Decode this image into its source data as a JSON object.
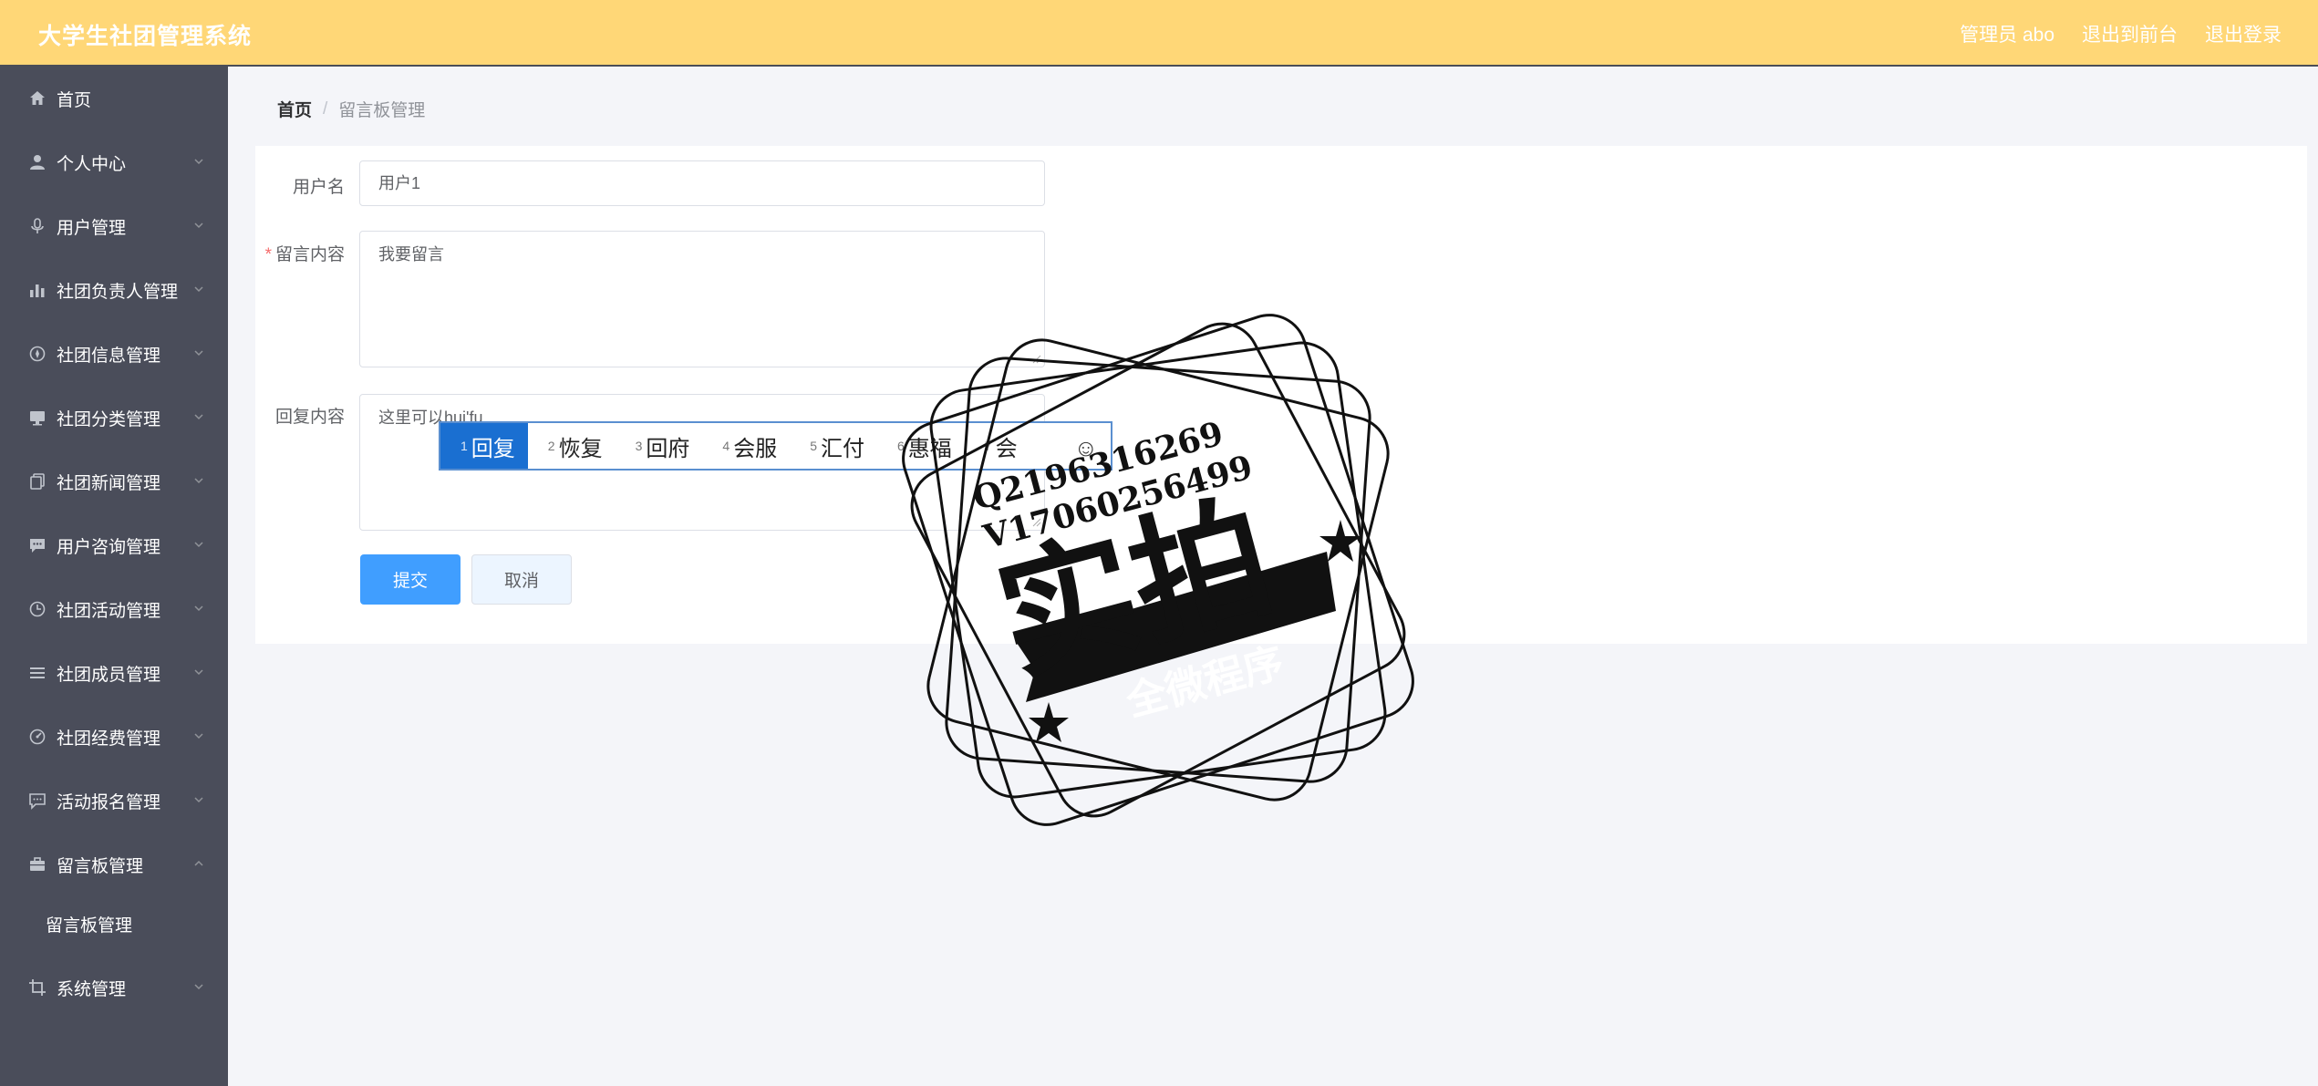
{
  "header": {
    "title": "大学生社团管理系统",
    "user": "管理员 abo",
    "to_frontend": "退出到前台",
    "logout": "退出登录"
  },
  "sidebar": {
    "items": [
      {
        "label": "首页",
        "icon": "home-icon"
      },
      {
        "label": "个人中心",
        "icon": "user-icon"
      },
      {
        "label": "用户管理",
        "icon": "microphone-icon"
      },
      {
        "label": "社团负责人管理",
        "icon": "bar-chart-icon"
      },
      {
        "label": "社团信息管理",
        "icon": "compass-icon"
      },
      {
        "label": "社团分类管理",
        "icon": "monitor-icon"
      },
      {
        "label": "社团新闻管理",
        "icon": "copy-icon"
      },
      {
        "label": "用户咨询管理",
        "icon": "chat-icon"
      },
      {
        "label": "社团活动管理",
        "icon": "clock-icon"
      },
      {
        "label": "社团成员管理",
        "icon": "list-icon"
      },
      {
        "label": "社团经费管理",
        "icon": "gauge-icon"
      },
      {
        "label": "活动报名管理",
        "icon": "message-icon"
      },
      {
        "label": "留言板管理",
        "icon": "suitcase-icon"
      },
      {
        "label": "系统管理",
        "icon": "crop-icon"
      }
    ],
    "sub_item": "留言板管理"
  },
  "breadcrumb": {
    "home": "首页",
    "separator": "/",
    "current": "留言板管理"
  },
  "form": {
    "username_label": "用户名",
    "username_value": "用户1",
    "required_mark": "*",
    "content_label": "留言内容",
    "content_value": "我要留言",
    "reply_label": "回复内容",
    "reply_value": "这里可以hui'fu",
    "submit": "提交",
    "cancel": "取消"
  },
  "ime": {
    "candidates": [
      {
        "num": "1",
        "text": "回复"
      },
      {
        "num": "2",
        "text": "恢复"
      },
      {
        "num": "3",
        "text": "回府"
      },
      {
        "num": "4",
        "text": "会服"
      },
      {
        "num": "5",
        "text": "汇付"
      },
      {
        "num": "6",
        "text": "惠福"
      },
      {
        "num": "7",
        "text": "会"
      }
    ],
    "emoji": "☺"
  },
  "watermark": {
    "line1": "Q2196316269",
    "line2": "V17060256499",
    "main": "实拍",
    "ribbon": "全微程序"
  },
  "colors": {
    "header_bg": "#ffd777",
    "sidebar_bg": "#4a4d5a",
    "primary": "#409eff",
    "required": "#f56c6c"
  }
}
